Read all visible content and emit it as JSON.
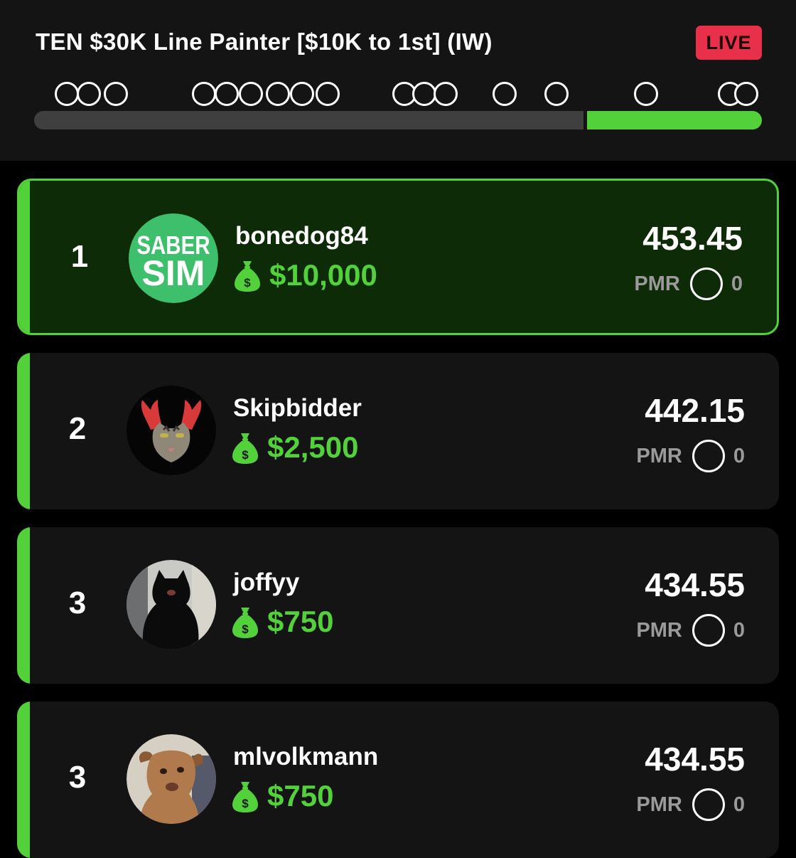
{
  "contest": {
    "title": "TEN $30K Line Painter [$10K to 1st] (IW)",
    "status_badge": "LIVE",
    "progress_fraction": 0.755
  },
  "colors": {
    "accent": "#52d13b",
    "live": "#e8304a",
    "card_bg": "#141414",
    "leader_bg": "#0d2b07"
  },
  "leaderboard": [
    {
      "rank": "1",
      "username": "bonedog84",
      "prize": "$10,000",
      "score": "453.45",
      "pmr_label": "PMR",
      "pmr_value": "0",
      "avatar_lines": [
        "SABER",
        "SIM"
      ]
    },
    {
      "rank": "2",
      "username": "Skipbidder",
      "prize": "$2,500",
      "score": "442.15",
      "pmr_label": "PMR",
      "pmr_value": "0"
    },
    {
      "rank": "3",
      "username": "joffyy",
      "prize": "$750",
      "score": "434.55",
      "pmr_label": "PMR",
      "pmr_value": "0"
    },
    {
      "rank": "3",
      "username": "mlvolkmann",
      "prize": "$750",
      "score": "434.55",
      "pmr_label": "PMR",
      "pmr_value": "0"
    }
  ]
}
